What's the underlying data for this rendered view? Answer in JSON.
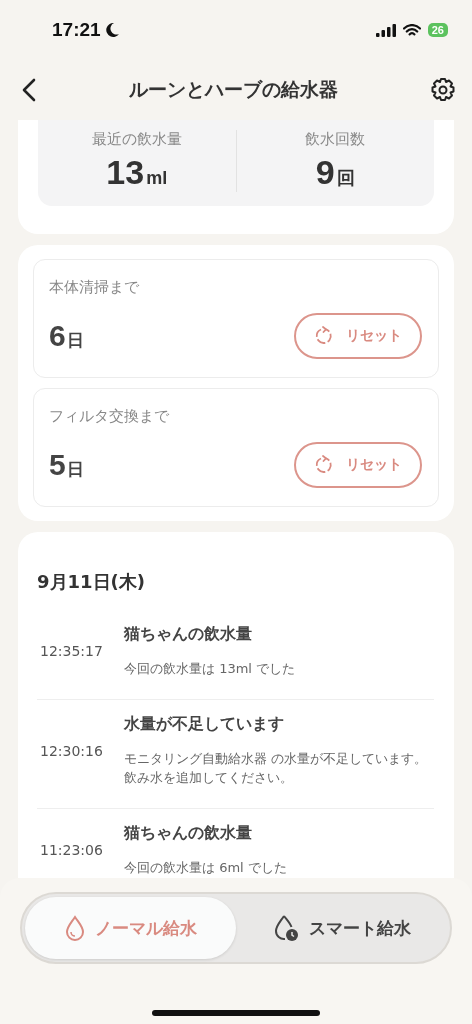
{
  "status_bar": {
    "time": "17:21",
    "battery": "26"
  },
  "header": {
    "title": "ルーンとハーブの給水器"
  },
  "stats": [
    {
      "label": "最近の飲水量",
      "value": "13",
      "unit": "ml"
    },
    {
      "label": "飲水回数",
      "value": "9",
      "unit": "回"
    }
  ],
  "maintenance": [
    {
      "label": "本体清掃まで",
      "value": "6",
      "unit": "日",
      "button": "リセット"
    },
    {
      "label": "フィルタ交換まで",
      "value": "5",
      "unit": "日",
      "button": "リセット"
    }
  ],
  "log": {
    "date": "9月11日(木)",
    "entries": [
      {
        "time": "12:35:17",
        "title": "猫ちゃんの飲水量",
        "message": "今回の飲水量は 13ml でした"
      },
      {
        "time": "12:30:16",
        "title": "水量が不足しています",
        "message": "モニタリング自動給水器 の水量が不足しています。飲み水を追加してください。"
      },
      {
        "time": "11:23:06",
        "title": "猫ちゃんの飲水量",
        "message": "今回の飲水量は 6ml でした"
      }
    ]
  },
  "mode_tabs": [
    {
      "label": "ノーマル給水",
      "kind": "normal",
      "selected": true
    },
    {
      "label": "スマート給水",
      "kind": "smart",
      "selected": false
    }
  ]
}
